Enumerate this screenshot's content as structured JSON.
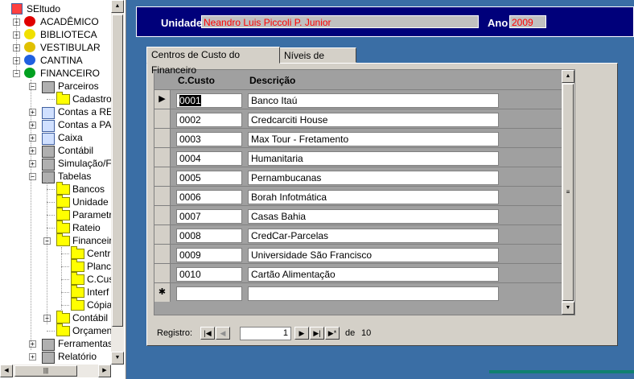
{
  "tree": {
    "root": "SEltudo",
    "items": [
      {
        "label": "ACADÊMICO",
        "color": "#e00000"
      },
      {
        "label": "BIBLIOTECA",
        "color": "#f0e000"
      },
      {
        "label": "VESTIBULAR",
        "color": "#e0c000"
      },
      {
        "label": "CANTINA",
        "color": "#2060e0"
      },
      {
        "label": "FINANCEIRO",
        "color": "#00a020"
      }
    ],
    "financeiro_children": [
      "Parceiros",
      "Cadastro",
      "Contas a REC",
      "Contas a PAG",
      "Caixa",
      "Contábil",
      "Simulação/Fe",
      "Tabelas",
      "Bancos",
      "Unidade",
      "Parametr",
      "Rateio",
      "Financeiro",
      "Centr",
      "Planc",
      "C.Cus",
      "Interf",
      "Cópia",
      "Contábil",
      "Orçament",
      "Ferramentas",
      "Relatório"
    ]
  },
  "header": {
    "unidade_label": "Unidade",
    "unidade_value": "Neandro Luis Piccoli P. Junior",
    "ano_label": "Ano",
    "ano_value": "2009"
  },
  "tabs": [
    {
      "label": "Centros de Custo do Financeiro",
      "active": true
    },
    {
      "label": "Níveis de C.Custo",
      "active": false
    }
  ],
  "grid": {
    "col_code": "C.Custo",
    "col_desc": "Descrição",
    "rows": [
      {
        "code": "0001",
        "desc": "Banco Itaú"
      },
      {
        "code": "0002",
        "desc": "Credcarciti House"
      },
      {
        "code": "0003",
        "desc": "Max Tour - Fretamento"
      },
      {
        "code": "0004",
        "desc": "Humanitaria"
      },
      {
        "code": "0005",
        "desc": "Pernambucanas"
      },
      {
        "code": "0006",
        "desc": "Borah Infotmática"
      },
      {
        "code": "0007",
        "desc": "Casas Bahia"
      },
      {
        "code": "0008",
        "desc": "CredCar-Parcelas"
      },
      {
        "code": "0009",
        "desc": "Universidade São Francisco"
      },
      {
        "code": "0010",
        "desc": "Cartão Alimentação"
      }
    ]
  },
  "nav": {
    "label": "Registro:",
    "current": "1",
    "of_label": "de",
    "total": "10"
  },
  "colors": {
    "background": "#3a6ea5",
    "header_bg": "#00007a",
    "value_text": "#ff0000"
  }
}
